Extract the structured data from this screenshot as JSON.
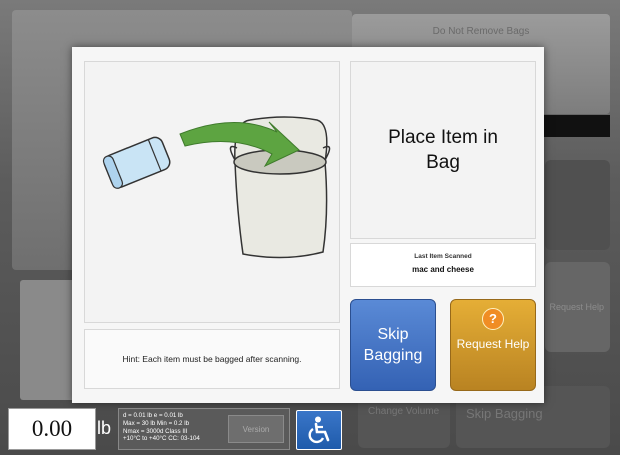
{
  "background": {
    "do_not_remove_label": "Do Not Remove Bags",
    "request_help_label": "Request Help",
    "change_volume_label": "Change Volume",
    "skip_bagging_label": "Skip Bagging"
  },
  "modal": {
    "instruction": "Place Item in Bag",
    "last_item_title": "Last Item Scanned",
    "last_item_name": "mac and cheese",
    "hint": "Hint: Each item must be bagged after scanning.",
    "skip_bagging_label": "Skip Bagging",
    "request_help_label": "Request Help",
    "help_icon_glyph": "?",
    "colors": {
      "skip": "#3f6fc2",
      "help": "#d29a2c"
    }
  },
  "scale": {
    "weight": "0.00",
    "unit": "lb",
    "spec_lines": [
      "d = 0.01 lb    e = 0.01 lb",
      "Max = 30 lb   Min = 0.2 lb",
      "Nmax = 3000d    Class  III",
      "+10°C  to  +40°C    CC: 03-104"
    ],
    "version_label": "Version",
    "accessibility_icon": "wheelchair-icon"
  }
}
